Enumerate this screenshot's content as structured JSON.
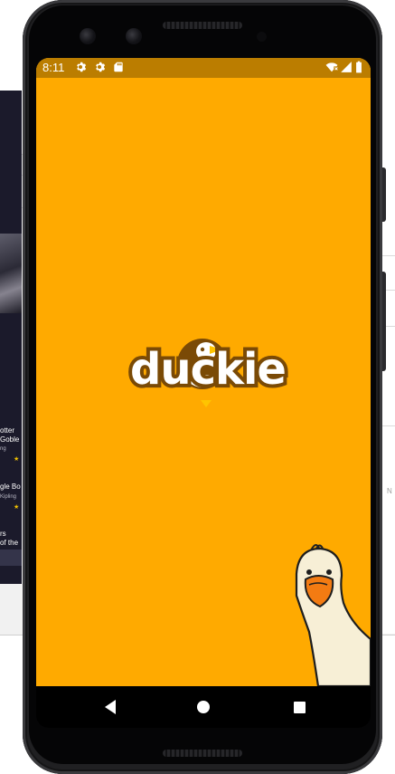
{
  "status_bar": {
    "time": "8:11",
    "left_icons": [
      "settings-icon",
      "settings-icon",
      "sd-card-icon"
    ],
    "right_icons": [
      "wifi-off-icon",
      "signal-icon",
      "battery-icon"
    ]
  },
  "splash": {
    "logo_text": "duckie",
    "background_color": "#ffaa00",
    "status_bar_color": "#bb7d00",
    "logo_color": "#7a4a06"
  },
  "nav_bar": {
    "buttons": [
      "back-icon",
      "home-icon",
      "recent-apps-icon"
    ]
  },
  "background_window": {
    "left_panel_texts": [
      "otter",
      "Goble",
      "ng",
      "gle Bo",
      "Kipling",
      "rs",
      "of the"
    ],
    "right_panel_texts": [
      "N"
    ]
  }
}
